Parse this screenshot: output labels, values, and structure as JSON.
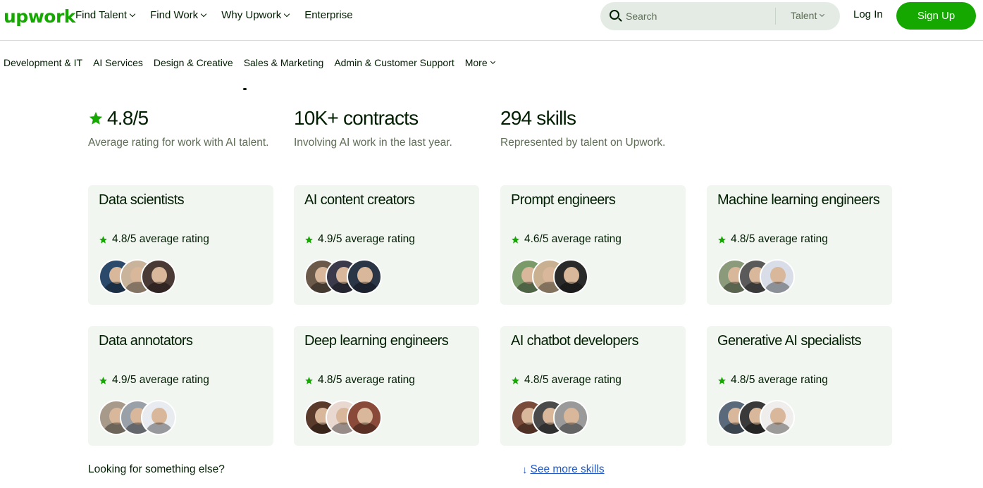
{
  "header": {
    "logo": "upwork",
    "nav": [
      {
        "label": "Find Talent",
        "dropdown": true
      },
      {
        "label": "Find Work",
        "dropdown": true
      },
      {
        "label": "Why Upwork",
        "dropdown": true
      },
      {
        "label": "Enterprise",
        "dropdown": false
      }
    ],
    "search": {
      "placeholder": "Search",
      "scope": "Talent"
    },
    "login": "Log In",
    "signup": "Sign Up"
  },
  "categories": [
    {
      "label": "Development & IT",
      "dropdown": false
    },
    {
      "label": "AI Services",
      "dropdown": false
    },
    {
      "label": "Design & Creative",
      "dropdown": false
    },
    {
      "label": "Sales & Marketing",
      "dropdown": false
    },
    {
      "label": "Admin & Customer Support",
      "dropdown": false
    },
    {
      "label": "More",
      "dropdown": true
    }
  ],
  "stats": [
    {
      "value": "4.8/5",
      "desc": "Average rating for work with AI talent.",
      "star": true
    },
    {
      "value": "10K+ contracts",
      "desc": "Involving AI work in the last year.",
      "star": false
    },
    {
      "value": "294 skills",
      "desc": "Represented by talent on Upwork.",
      "star": false
    }
  ],
  "cards": [
    {
      "title": "Data scientists",
      "rating": "4.8/5 average rating",
      "avatars": [
        "#2b4a6b",
        "#c9b39a",
        "#4a3a35"
      ]
    },
    {
      "title": "AI content creators",
      "rating": "4.9/5 average rating",
      "avatars": [
        "#6b5a4a",
        "#3a3a4a",
        "#2a3545"
      ]
    },
    {
      "title": "Prompt engineers",
      "rating": "4.6/5 average rating",
      "avatars": [
        "#7a9a6a",
        "#c8b090",
        "#2a2a2a"
      ]
    },
    {
      "title": "Machine learning engineers",
      "rating": "4.8/5 average rating",
      "avatars": [
        "#8a9a7a",
        "#5a5a5a",
        "#d8dde8"
      ]
    },
    {
      "title": "Data annotators",
      "rating": "4.9/5 average rating",
      "avatars": [
        "#a89a8a",
        "#9aa0a8",
        "#e8ecf0"
      ]
    },
    {
      "title": "Deep learning engineers",
      "rating": "4.8/5 average rating",
      "avatars": [
        "#5a3a2a",
        "#e8d8d0",
        "#8a4a3a"
      ]
    },
    {
      "title": "AI chatbot developers",
      "rating": "4.8/5 average rating",
      "avatars": [
        "#7a4a3a",
        "#4a4a4a",
        "#9a9a9a"
      ]
    },
    {
      "title": "Generative AI specialists",
      "rating": "4.8/5 average rating",
      "avatars": [
        "#5a6a7a",
        "#3a3a3a",
        "#f0eeec"
      ]
    }
  ],
  "footer": {
    "looking": "Looking for something else?",
    "see_more": "See more skills"
  },
  "colors": {
    "brand": "#14a800",
    "text": "#001e00",
    "muted": "#5e6d55",
    "card_bg": "#f1f6f1",
    "link": "#1f57c3"
  },
  "icons": {
    "star": "star-icon",
    "search": "search-icon",
    "chevron": "chevron-down-icon",
    "arrow": "arrow-down-icon"
  }
}
